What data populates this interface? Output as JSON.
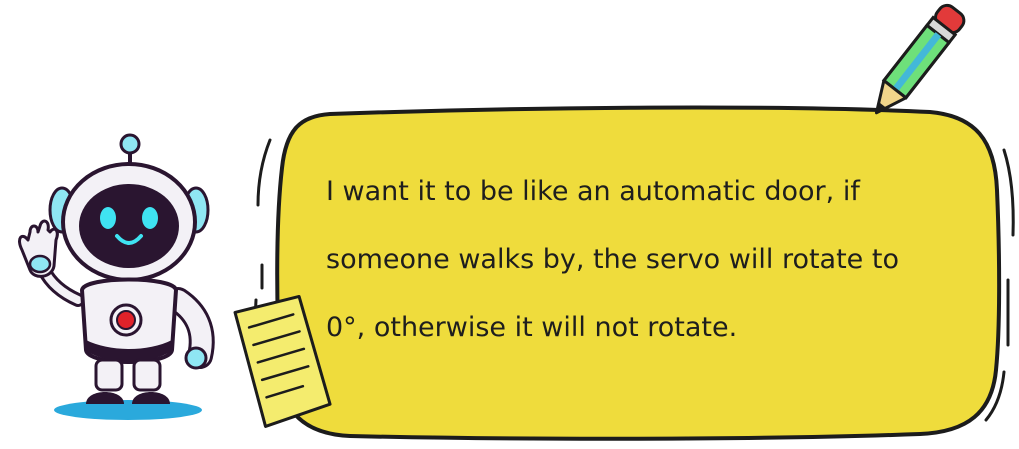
{
  "speech_bubble": {
    "lines": [
      "I want it to be like an automatic door, if",
      "someone walks by, the servo will rotate to",
      "0°, otherwise it will not rotate."
    ]
  },
  "colors": {
    "bubble_fill": "#efdc3c",
    "outline": "#1c1c1c",
    "robot_visor": "#2a1530",
    "robot_eyes": "#3fe3f2",
    "robot_shadow": "#2aa9dc",
    "robot_chest_button": "#e0222a",
    "pencil_body": "#6ee07a",
    "pencil_stripe": "#43b8d8",
    "pencil_eraser": "#e23a3a",
    "note_fill": "#f4ec6e"
  },
  "icons": {
    "robot": "waving-robot-mascot",
    "pencil": "pencil-icon",
    "note": "sticky-note-icon"
  }
}
